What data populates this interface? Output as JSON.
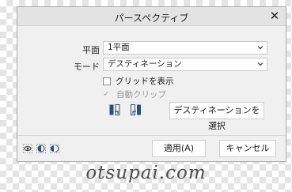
{
  "dialog": {
    "title": "パースペクティブ",
    "close_glyph": "✕"
  },
  "plane": {
    "label": "平面",
    "value": "1平面"
  },
  "mode": {
    "label": "モード",
    "value": "デスティネーション"
  },
  "grid_checkbox": {
    "label": "グリッドを表示",
    "checked": false
  },
  "auto_clip": {
    "label": "自動クリップ",
    "checked": true,
    "enabled": false
  },
  "buttons": {
    "select_destination": "デスティネーションを選択",
    "apply": "適用(A)",
    "cancel": "キャンセル"
  },
  "icons": {
    "tool1": "swap-right-icon",
    "tool2": "swap-left-icon",
    "footer": [
      "eye-preview-icon",
      "half-circle-compare-icon",
      "split-compare-icon"
    ]
  },
  "watermark": "otsupai.com"
}
